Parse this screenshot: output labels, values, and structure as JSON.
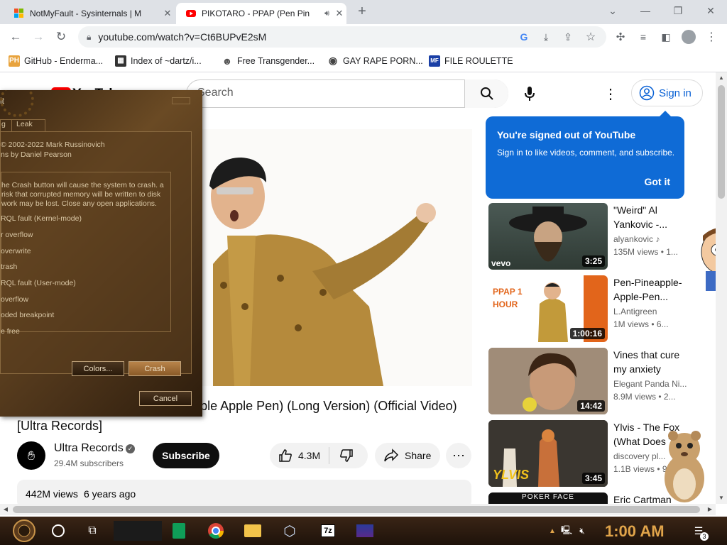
{
  "browser": {
    "tabs": [
      {
        "title": "NotMyFault - Sysinternals | M",
        "close": "✕"
      },
      {
        "title": "PIKOTARO - PPAP (Pen Pin",
        "close": "✕"
      }
    ],
    "new_tab": "+",
    "url": "youtube.com/watch?v=Ct6BUPvE2sM",
    "bookmarks": [
      {
        "label": "GitHub - Enderma...",
        "icon": "PH",
        "color": "#e8a33d"
      },
      {
        "label": "Index of ~dartz/i...",
        "icon": "▦",
        "color": "#333333"
      },
      {
        "label": "Free Transgender...",
        "icon": "☻",
        "color": "#555555"
      },
      {
        "label": "GAY RAPE PORN...",
        "icon": "◉",
        "color": "#444444"
      },
      {
        "label": "FILE ROULETTE",
        "icon": "MF",
        "color": "#1a3fa6"
      }
    ]
  },
  "youtube": {
    "logo": "YouTube",
    "search_placeholder": "Search",
    "signin": "Sign in",
    "popup": {
      "title": "You're signed out of YouTube",
      "body": "Sign in to like videos, comment, and subscribe.",
      "button": "Got it"
    },
    "video": {
      "title": "PIKOTARO - PPAP (Pen Pineapple Apple Pen) (Long Version) (Official Video) [Ultra Records]",
      "channel": "Ultra Records",
      "subscribers": "29.4M subscribers",
      "subscribe": "Subscribe",
      "likes": "4.3M",
      "share": "Share",
      "views": "442M views",
      "age": "6 years ago"
    },
    "recommendations": [
      {
        "title": "\"Weird\" Al Yankovic -...",
        "channel": "alyankovic ♪",
        "meta": "135M views • 1...",
        "duration": "3:25",
        "badge": "vevo"
      },
      {
        "title": "Pen-Pineapple-Apple-Pen...",
        "channel": "L.Antigreen",
        "meta": "1M views • 6...",
        "duration": "1:00:16",
        "badge": "PPAP 1 HOUR"
      },
      {
        "title": "Vines that cure my anxiety",
        "channel": "Elegant Panda Ni...",
        "meta": "8.9M views • 2...",
        "duration": "14:42",
        "badge": ""
      },
      {
        "title": "Ylvis - The Fox (What Does T...",
        "channel": "discovery pl...",
        "meta": "1.1B views • 9...",
        "duration": "3:45",
        "badge": "YLVIS"
      },
      {
        "title": "Eric Cartman",
        "channel": "",
        "meta": "",
        "duration": "",
        "badge": "POKER FACE"
      }
    ]
  },
  "notmyfault": {
    "title": "lt",
    "tabs": [
      "g",
      "Leak"
    ],
    "copyright": "© 2002-2022 Mark Russinovich",
    "author": "ns by Daniel Pearson",
    "warning": "he Crash button will cause the system to crash. a risk that corrupted memory will be written to disk work may be lost. Close any open applications.",
    "options": [
      "RQL fault (Kernel-mode)",
      "r overflow",
      "overwrite",
      "trash",
      "RQL fault (User-mode)",
      "overflow",
      "oded breakpoint",
      "e free"
    ],
    "colors_button": "Colors...",
    "crash_button": "Crash",
    "cancel_button": "Cancel"
  },
  "taskbar": {
    "time": "1:00 AM",
    "notifications": "3"
  }
}
